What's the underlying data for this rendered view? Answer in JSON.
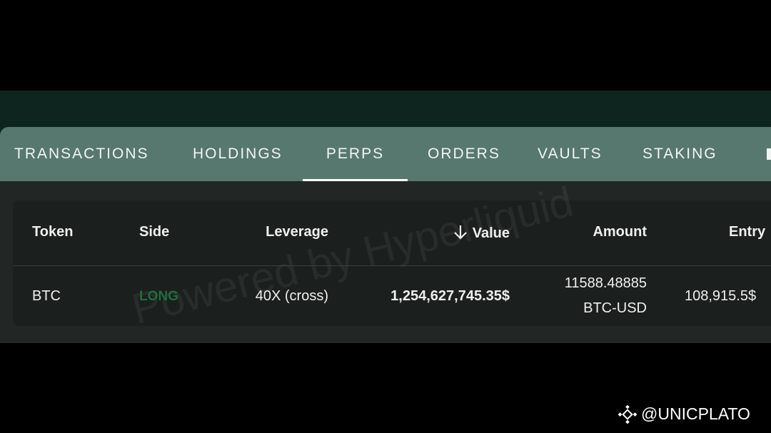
{
  "tabs": [
    {
      "label": "TRANSACTIONS",
      "active": false
    },
    {
      "label": "HOLDINGS",
      "active": false
    },
    {
      "label": "PERPS",
      "active": true
    },
    {
      "label": "ORDERS",
      "active": false
    },
    {
      "label": "VAULTS",
      "active": false
    },
    {
      "label": "STAKING",
      "active": false
    }
  ],
  "table": {
    "headers": {
      "token": "Token",
      "side": "Side",
      "leverage": "Leverage",
      "value": "Value",
      "amount": "Amount",
      "entry": "Entry"
    },
    "sort": {
      "column": "value",
      "direction": "desc",
      "icon": "arrow-down-icon"
    },
    "rows": [
      {
        "token": "BTC",
        "side": "LONG",
        "leverage": "40X (cross)",
        "value": "1,254,627,745.35$",
        "amount_qty": "11588.48885",
        "amount_unit": "BTC-USD",
        "entry": "108,915.5$"
      }
    ]
  },
  "watermark": "Powered by Hyperliquid",
  "footer": {
    "logo_icon": "binance-square-icon",
    "handle": "@UNICPLATO"
  },
  "colors": {
    "background": "#000000",
    "frame": "#0e241e",
    "tab_bar": "#57786e",
    "card": "#222725",
    "table": "#1b1f1d",
    "long": "#1f6e3a",
    "text": "#eef0ef"
  }
}
